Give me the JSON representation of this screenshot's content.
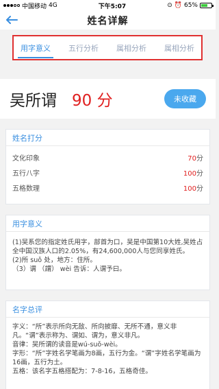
{
  "status_bar": {
    "carrier": "中国移动",
    "network": "4G",
    "time": "下午5:07",
    "battery": "65%",
    "battery_level": 0.65
  },
  "nav": {
    "title": "姓名详解"
  },
  "tabs": [
    {
      "label": "用字意义",
      "active": true
    },
    {
      "label": "五行分析",
      "active": false
    },
    {
      "label": "属相分析",
      "active": false
    },
    {
      "label": "属相分析",
      "active": false
    }
  ],
  "name_card": {
    "name": "吴所谓",
    "score": "90 分",
    "favorite_button": "未收藏"
  },
  "scoring": {
    "title": "姓名打分",
    "rows": [
      {
        "label": "文化印象",
        "value": "70",
        "unit": "分"
      },
      {
        "label": "五行八字",
        "value": "100",
        "unit": "分"
      },
      {
        "label": "五格数理",
        "value": "100",
        "unit": "分"
      }
    ]
  },
  "char_meaning": {
    "title": "用字意义",
    "lines": [
      "(1)吴系您的指定姓氏用字，部首为口，吴是中国第10大姓,吴姓占全中国汉族人口的2.05%，有24,600,000人与您同享姓氏。",
      "(2)所 suǒ 处，地方：住所。",
      "（3）谓 （謂） wèi 告诉：人谓予曰。"
    ]
  },
  "summary": {
    "title": "名字总评",
    "lines": [
      "字义：“所”表示所向无敌、所向披靡、无所不通，意义非凡。“谓”表示称为、谓如、谓为，意义非凡。",
      "音律：吴所谓的读音是wú-suǒ-wèi。",
      "字形：“所”字姓名学笔画为8画，五行为金。“谓”字姓名学笔画为16画，五行为土。",
      "五格：该名字五格搭配为：7-8-16，五格奇佳。"
    ]
  }
}
